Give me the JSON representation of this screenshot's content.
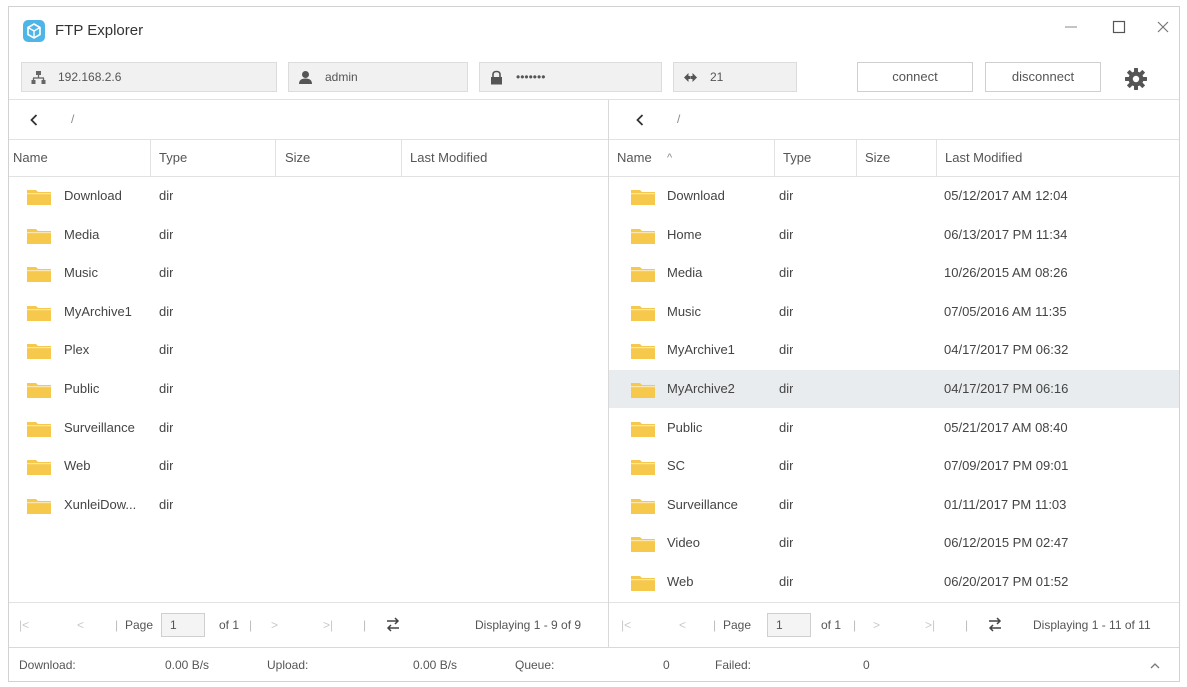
{
  "app": {
    "title": "FTP Explorer"
  },
  "connection": {
    "host": "192.168.2.6",
    "user": "admin",
    "password": "•••••••",
    "port": "21",
    "connect_label": "connect",
    "disconnect_label": "disconnect"
  },
  "left": {
    "path": "/",
    "columns": {
      "name": "Name",
      "type": "Type",
      "size": "Size",
      "modified": "Last Modified"
    },
    "rows": [
      {
        "name": "Download",
        "type": "dir",
        "size": "",
        "modified": ""
      },
      {
        "name": "Media",
        "type": "dir",
        "size": "",
        "modified": ""
      },
      {
        "name": "Music",
        "type": "dir",
        "size": "",
        "modified": ""
      },
      {
        "name": "MyArchive1",
        "type": "dir",
        "size": "",
        "modified": ""
      },
      {
        "name": "Plex",
        "type": "dir",
        "size": "",
        "modified": ""
      },
      {
        "name": "Public",
        "type": "dir",
        "size": "",
        "modified": ""
      },
      {
        "name": "Surveillance",
        "type": "dir",
        "size": "",
        "modified": ""
      },
      {
        "name": "Web",
        "type": "dir",
        "size": "",
        "modified": ""
      },
      {
        "name": "XunleiDow...",
        "type": "dir",
        "size": "",
        "modified": ""
      }
    ],
    "pager": {
      "page_label": "Page",
      "page": "1",
      "of": "of 1",
      "display": "Displaying 1 - 9 of 9"
    }
  },
  "right": {
    "path": "/",
    "columns": {
      "name": "Name",
      "type": "Type",
      "size": "Size",
      "modified": "Last Modified"
    },
    "sort_indicator": "^",
    "selected_index": 5,
    "rows": [
      {
        "name": "Download",
        "type": "dir",
        "size": "",
        "modified": "05/12/2017 AM 12:04"
      },
      {
        "name": "Home",
        "type": "dir",
        "size": "",
        "modified": "06/13/2017 PM 11:34"
      },
      {
        "name": "Media",
        "type": "dir",
        "size": "",
        "modified": "10/26/2015 AM 08:26"
      },
      {
        "name": "Music",
        "type": "dir",
        "size": "",
        "modified": "07/05/2016 AM 11:35"
      },
      {
        "name": "MyArchive1",
        "type": "dir",
        "size": "",
        "modified": "04/17/2017 PM 06:32"
      },
      {
        "name": "MyArchive2",
        "type": "dir",
        "size": "",
        "modified": "04/17/2017 PM 06:16"
      },
      {
        "name": "Public",
        "type": "dir",
        "size": "",
        "modified": "05/21/2017 AM 08:40"
      },
      {
        "name": "SC",
        "type": "dir",
        "size": "",
        "modified": "07/09/2017 PM 09:01"
      },
      {
        "name": "Surveillance",
        "type": "dir",
        "size": "",
        "modified": "01/11/2017 PM 11:03"
      },
      {
        "name": "Video",
        "type": "dir",
        "size": "",
        "modified": "06/12/2015 PM 02:47"
      },
      {
        "name": "Web",
        "type": "dir",
        "size": "",
        "modified": "06/20/2017 PM 01:52"
      }
    ],
    "pager": {
      "page_label": "Page",
      "page": "1",
      "of": "of 1",
      "display": "Displaying 1 - 11 of 11"
    }
  },
  "status": {
    "download_label": "Download:",
    "download_value": "0.00 B/s",
    "upload_label": "Upload:",
    "upload_value": "0.00 B/s",
    "queue_label": "Queue:",
    "queue_value": "0",
    "failed_label": "Failed:",
    "failed_value": "0"
  },
  "colors": {
    "folder": "#f6c84c",
    "selection": "#e8ecef",
    "app_icon": "#4fb5e6"
  },
  "icons": [
    "app-icon",
    "network-icon",
    "user-icon",
    "lock-icon",
    "port-icon",
    "gear-icon",
    "back-icon",
    "folder-icon",
    "first-page-icon",
    "prev-page-icon",
    "next-page-icon",
    "last-page-icon",
    "refresh-icon",
    "chevron-up-icon"
  ]
}
